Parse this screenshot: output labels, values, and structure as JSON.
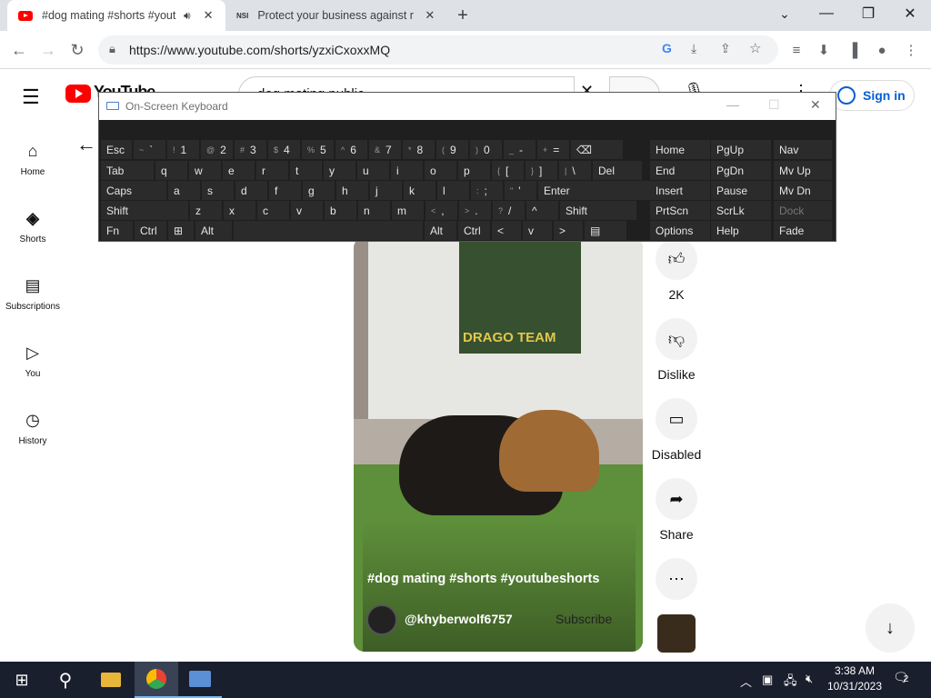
{
  "browser": {
    "tabs": [
      {
        "title": "#dog mating #shorts #yout",
        "favicon": "youtube-icon"
      },
      {
        "title": "Protect your business against ne",
        "favicon": "nsi-icon"
      }
    ],
    "url": "https://www.youtube.com/shorts/yzxiCxoxxMQ",
    "window_controls": {
      "minimize": "—",
      "restore": "❐",
      "close": "✕"
    }
  },
  "youtube": {
    "logo_text": "YouTube",
    "search_value": "dog mating public",
    "sign_in_label": "Sign in",
    "sidebar": [
      {
        "label": "Home",
        "icon": "home-icon"
      },
      {
        "label": "Shorts",
        "icon": "shorts-icon"
      },
      {
        "label": "Subscriptions",
        "icon": "subscriptions-icon"
      },
      {
        "label": "You",
        "icon": "you-icon"
      },
      {
        "label": "History",
        "icon": "history-icon"
      }
    ],
    "video": {
      "title": "#dog mating #shorts #youtubeshorts",
      "channel": "@khyberwolf6757",
      "subscribe_label": "Subscribe",
      "sign_text": "DRAGO TEAM"
    },
    "actions": {
      "like_count": "2K",
      "dislike_label": "Dislike",
      "comments_label": "Disabled",
      "share_label": "Share"
    }
  },
  "keyboard": {
    "title": "On-Screen Keyboard",
    "rows": [
      [
        "Esc",
        "~ `",
        "! 1",
        "@ 2",
        "# 3",
        "$ 4",
        "% 5",
        "^ 6",
        "& 7",
        "* 8",
        "( 9",
        ") 0",
        "_ -",
        "+ =",
        "⌫"
      ],
      [
        "Tab",
        "q",
        "w",
        "e",
        "r",
        "t",
        "y",
        "u",
        "i",
        "o",
        "p",
        "{ [",
        "} ]",
        "| \\",
        "Del"
      ],
      [
        "Caps",
        "a",
        "s",
        "d",
        "f",
        "g",
        "h",
        "j",
        "k",
        "l",
        ": ;",
        "\" '",
        "Enter"
      ],
      [
        "Shift",
        "z",
        "x",
        "c",
        "v",
        "b",
        "n",
        "m",
        "< ,",
        "> .",
        "? /",
        "^",
        "Shift"
      ],
      [
        "Fn",
        "Ctrl",
        "⊞",
        "Alt",
        "",
        "Alt",
        "Ctrl",
        "<",
        "v",
        ">",
        "▤"
      ]
    ],
    "nav_keys": [
      [
        "Home",
        "PgUp",
        "Nav"
      ],
      [
        "End",
        "PgDn",
        "Mv Up"
      ],
      [
        "Insert",
        "Pause",
        "Mv Dn"
      ],
      [
        "PrtScn",
        "ScrLk",
        "Dock"
      ],
      [
        "Options",
        "Help",
        "Fade"
      ]
    ]
  },
  "taskbar": {
    "time": "3:38 AM",
    "date": "10/31/2023",
    "notification_count": "2"
  },
  "colors": {
    "youtube_red": "#ff0000",
    "sign_in_blue": "#065fd4",
    "taskbar": "#1a1f2e"
  }
}
